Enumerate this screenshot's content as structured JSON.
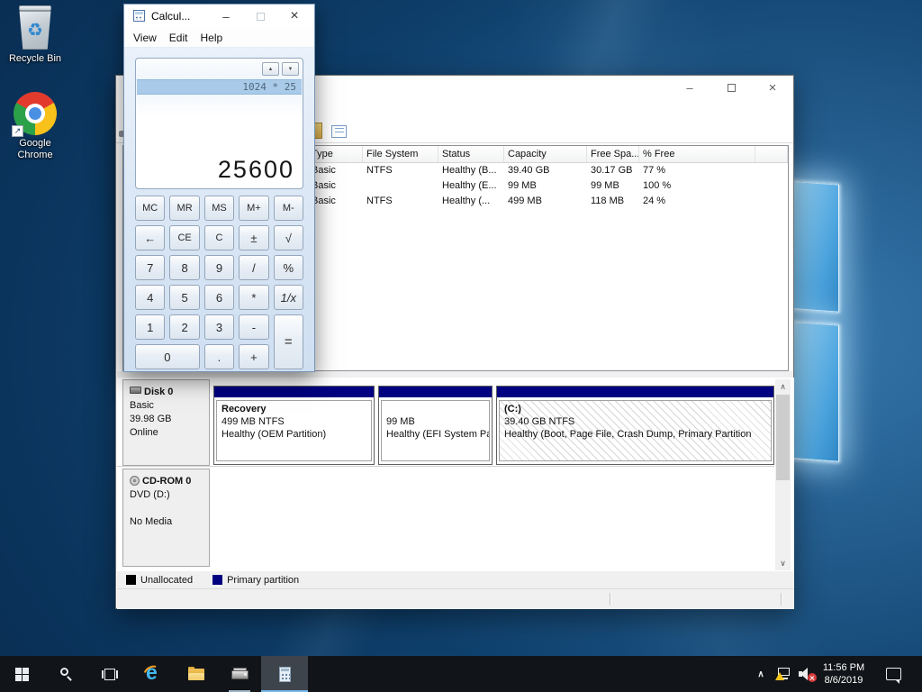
{
  "desktop": {
    "recycle_bin_label": "Recycle Bin",
    "chrome_label_line1": "Google",
    "chrome_label_line2": "Chrome"
  },
  "calculator": {
    "title": "Calcul...",
    "menu": {
      "view": "View",
      "edit": "Edit",
      "help": "Help"
    },
    "display": {
      "history_entry": "1024 * 25",
      "result": "25600"
    },
    "keypad": {
      "row1": [
        "MC",
        "MR",
        "MS",
        "M+",
        "M-"
      ],
      "row2": [
        "←",
        "CE",
        "C",
        "±",
        "√"
      ],
      "row3": [
        "7",
        "8",
        "9",
        "/",
        "%"
      ],
      "row4": [
        "4",
        "5",
        "6",
        "*",
        "1/x"
      ],
      "row5": [
        "1",
        "2",
        "3",
        "-"
      ],
      "zero": "0",
      "dot": ".",
      "plus": "+",
      "equals": "="
    }
  },
  "disk_management": {
    "volume_list": {
      "headers": {
        "type": "Type",
        "file_system": "File System",
        "status": "Status",
        "capacity": "Capacity",
        "free_space": "Free Spa...",
        "percent_free": "% Free"
      },
      "rows": [
        {
          "type": "Basic",
          "file_system": "NTFS",
          "status": "Healthy (B...",
          "capacity": "39.40 GB",
          "free_space": "30.17 GB",
          "percent_free": "77 %"
        },
        {
          "type": "Basic",
          "file_system": "",
          "status": "Healthy (E...",
          "capacity": "99 MB",
          "free_space": "99 MB",
          "percent_free": "100 %"
        },
        {
          "type": "Basic",
          "file_system": "NTFS",
          "status": "Healthy (...",
          "capacity": "499 MB",
          "free_space": "118 MB",
          "percent_free": "24 %"
        }
      ]
    },
    "disk0": {
      "name": "Disk 0",
      "type": "Basic",
      "size": "39.98 GB",
      "status": "Online"
    },
    "partitions": [
      {
        "name": "Recovery",
        "size_fs": "499 MB NTFS",
        "status": "Healthy (OEM Partition)"
      },
      {
        "name": "",
        "size_fs": "99 MB",
        "status": "Healthy (EFI System Pa"
      },
      {
        "name": "(C:)",
        "size_fs": "39.40 GB NTFS",
        "status": "Healthy (Boot, Page File, Crash Dump, Primary Partition"
      }
    ],
    "cdrom": {
      "name": "CD-ROM 0",
      "drive": "DVD (D:)",
      "media": "No Media"
    },
    "legend": {
      "unallocated": "Unallocated",
      "primary": "Primary partition"
    },
    "colors": {
      "primary_partition": "#000080",
      "unallocated": "#000000"
    }
  },
  "taskbar": {
    "clock": {
      "time": "11:56 PM",
      "date": "8/6/2019"
    }
  },
  "glyphs": {
    "minimize": "–",
    "close": "×",
    "spinner_up": "▲",
    "spinner_down": "▼",
    "scroll_up": "∧",
    "scroll_down": "∨",
    "tray_chevron": "∧",
    "shortcut_arrow": "↗",
    "recycle_symbol": "♻"
  }
}
